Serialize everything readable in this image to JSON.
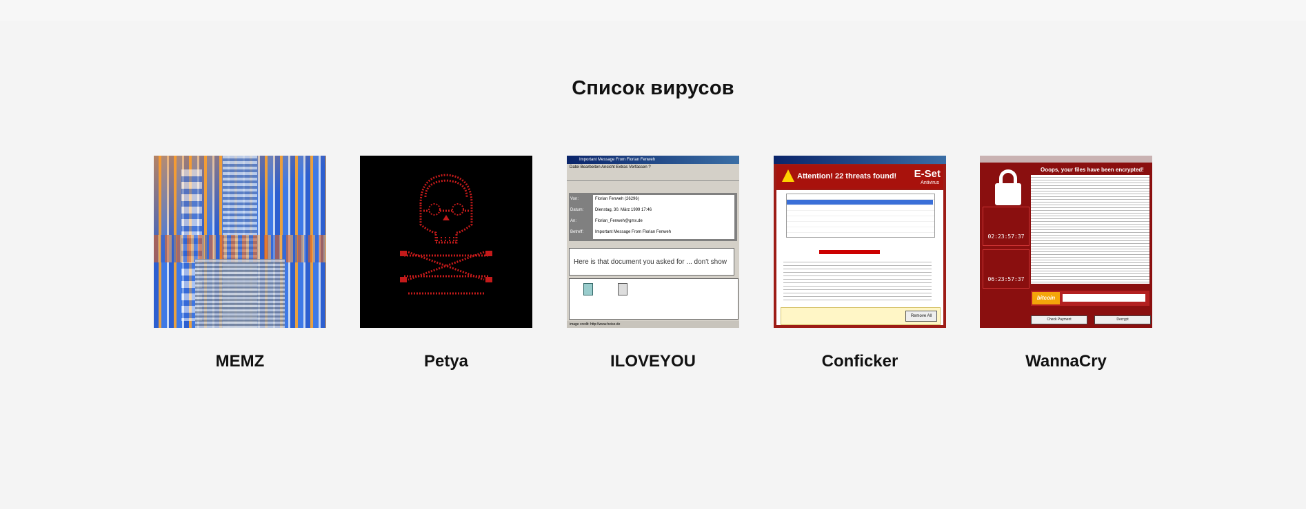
{
  "page": {
    "title": "Список вирусов"
  },
  "viruses": [
    {
      "name": "MEMZ"
    },
    {
      "name": "Petya"
    },
    {
      "name": "ILOVEYOU"
    },
    {
      "name": "Conficker"
    },
    {
      "name": "WannaCry"
    }
  ],
  "thumbnails": {
    "iloveyou": {
      "window_title": "Important Message From Florian Fenweh",
      "message": "Here is that document you asked for ... don't show anyone else ;-)",
      "from_label": "Von:",
      "from": "Florian Fenweh (26296)",
      "date_label": "Datum:",
      "date": "Dienstag, 30. März 1999 17:46",
      "to_label": "An:",
      "to": "Florian_Fenweh@gmx.de",
      "subject_label": "Betreff:",
      "subject": "Important Message From Florian Fenweh",
      "status": "image credit: http://www.heise.de"
    },
    "conficker": {
      "headline": "Attention! 22 threats found!",
      "brand": "E-Set",
      "brand_sub": "Antivirus",
      "button": "Remove All"
    },
    "wannacry": {
      "headline": "Ooops, your files have been encrypted!",
      "timer1": "02:23:57:37",
      "timer2": "06:23:57:37",
      "btc_logo": "bitcoin",
      "check_button": "Check Payment",
      "decrypt_button": "Decrypt"
    }
  },
  "colors": {
    "background": "#f4f4f4",
    "title": "#111111",
    "wannacry_red": "#8a0f0f",
    "petya_red": "#c41a1a"
  }
}
